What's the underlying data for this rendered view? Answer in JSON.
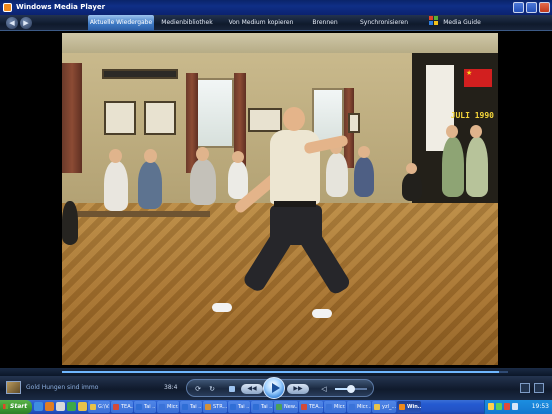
{
  "window": {
    "title": "Windows Media Player"
  },
  "nav": {
    "back_icon": "back-arrow-icon",
    "forward_icon": "forward-arrow-icon",
    "tabs": [
      {
        "label": "Aktuelle Wiedergabe",
        "active": true
      },
      {
        "label": "Medienbibliothek",
        "active": false
      },
      {
        "label": "Von Medium kopieren",
        "active": false
      },
      {
        "label": "Brennen",
        "active": false
      },
      {
        "label": "Synchronisieren",
        "active": false
      },
      {
        "label": "Media Guide",
        "active": false,
        "icon": "windows-flag-icon"
      }
    ]
  },
  "video": {
    "date_stamp": "JULI 1990",
    "progress": 0.98
  },
  "controls": {
    "track_title": "Gold Hungen sind immo",
    "time": "38:4",
    "volume": 0.5,
    "accent_color": "#2f7fd8"
  },
  "taskbar": {
    "start_label": "Start",
    "items": [
      {
        "label": "G:\\V...",
        "active": false,
        "color": "#e8c34a"
      },
      {
        "label": "TEA...",
        "active": false,
        "color": "#d34a3a"
      },
      {
        "label": "Tai ...",
        "active": false,
        "color": "#2f6ed6"
      },
      {
        "label": "Micr...",
        "active": false,
        "color": "#3a73d9"
      },
      {
        "label": "Tai ...",
        "active": false,
        "color": "#2f6ed6"
      },
      {
        "label": "STR...",
        "active": false,
        "color": "#d3903a"
      },
      {
        "label": "Tai ...",
        "active": false,
        "color": "#2f6ed6"
      },
      {
        "label": "Tai ...",
        "active": false,
        "color": "#2f6ed6"
      },
      {
        "label": "New...",
        "active": false,
        "color": "#4aa05a"
      },
      {
        "label": "TEA...",
        "active": false,
        "color": "#d34a3a"
      },
      {
        "label": "Micr...",
        "active": false,
        "color": "#3a73d9"
      },
      {
        "label": "Micr...",
        "active": false,
        "color": "#3a73d9"
      },
      {
        "label": "yzl_...",
        "active": false,
        "color": "#e8c34a"
      },
      {
        "label": "Win...",
        "active": true,
        "color": "#f08a1c"
      }
    ],
    "clock": "19:53"
  }
}
